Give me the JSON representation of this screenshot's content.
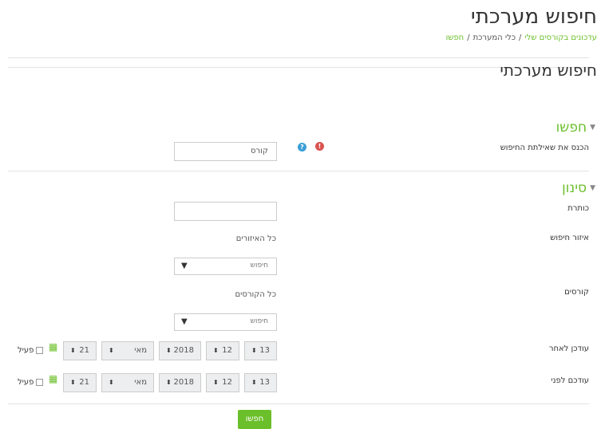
{
  "page": {
    "title": "חיפוש מערכתי",
    "breadcrumb": [
      "עדכונים בקורסים שלי",
      "כלי המערכת",
      "חפשו"
    ],
    "heading": "חיפוש מערכתי"
  },
  "search_section": {
    "legend": "חפשו",
    "query_label": "הכנס את שאילתת החיפוש",
    "query_value": "קורס"
  },
  "filter_section": {
    "legend": "סינון",
    "title_label": "כותרת",
    "title_value": "",
    "area_label": "איזור חיפוש",
    "area_selected": "כל האיזורים",
    "area_search_placeholder": "חיפוש",
    "courses_label": "קורסים",
    "courses_selected": "כל הקורסים",
    "courses_search_placeholder": "חיפוש",
    "modified_after": {
      "label": "עודכן לאחר",
      "day": "21",
      "month": "מאי",
      "year": "2018",
      "hour": "12",
      "minute": "13",
      "enable_label": "פעיל"
    },
    "modified_before": {
      "label": "עודכם לפני",
      "day": "21",
      "month": "מאי",
      "year": "2018",
      "hour": "12",
      "minute": "13",
      "enable_label": "פעיל"
    }
  },
  "submit_label": "חפשו",
  "colors": {
    "accent": "#6bbf2a",
    "help": "#3a9ed8",
    "required": "#d9534f"
  },
  "icons": [
    "help-icon",
    "required-icon",
    "calendar-icon",
    "dropdown-arrow-icon",
    "collapse-caret-icon"
  ]
}
